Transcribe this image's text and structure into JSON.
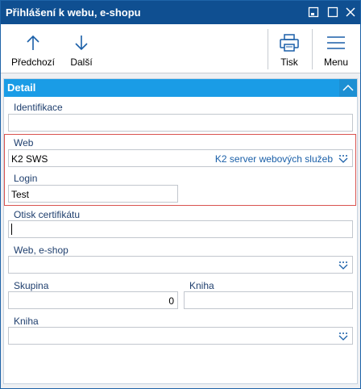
{
  "window": {
    "title": "Přihlášení k webu, e-shopu",
    "controls": [
      "restore-icon",
      "maximize-icon",
      "close-icon"
    ]
  },
  "toolbar": {
    "prev_label": "Předchozí",
    "next_label": "Další",
    "print_label": "Tisk",
    "menu_label": "Menu"
  },
  "section": {
    "title": "Detail"
  },
  "form": {
    "identifikace": {
      "label": "Identifikace",
      "value": ""
    },
    "web": {
      "label": "Web",
      "value": "K2 SWS",
      "description": "K2 server webových služeb"
    },
    "login": {
      "label": "Login",
      "value": "Test"
    },
    "otisk": {
      "label": "Otisk certifikátu",
      "value": ""
    },
    "web_eshop": {
      "label": "Web, e-shop",
      "value": ""
    },
    "skupina": {
      "label": "Skupina",
      "value": "0"
    },
    "kniha1": {
      "label": "Kniha",
      "value": ""
    },
    "kniha2": {
      "label": "Kniha",
      "value": ""
    }
  },
  "colors": {
    "titlebar": "#0f4f91",
    "section_header": "#1a9ce6",
    "highlight_border": "#d9534f",
    "link": "#1a5fa8"
  }
}
